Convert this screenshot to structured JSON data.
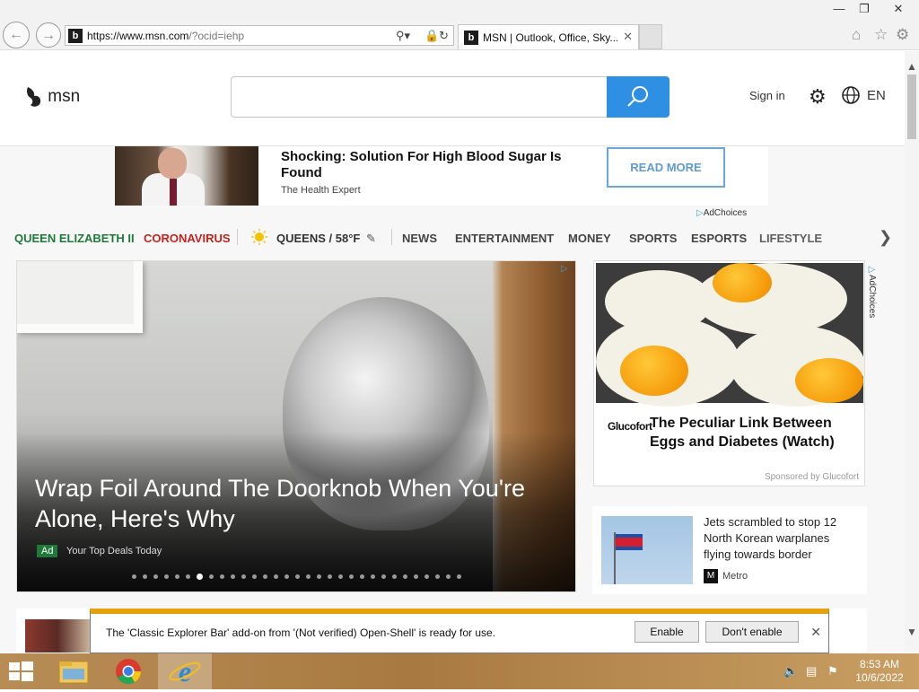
{
  "browser": {
    "url_main": "https://www.msn.com",
    "url_rest": "/?ocid=iehp",
    "tab_title": "MSN | Outlook, Office, Sky...",
    "favicon_letter": "b"
  },
  "msn": {
    "logo_text": "msn",
    "signin_label": "Sign in",
    "lang_label": "EN",
    "search_placeholder": ""
  },
  "ad_banner": {
    "title": "Shocking: Solution For High Blood Sugar Is Found",
    "source": "The Health Expert",
    "cta": "READ MORE",
    "adchoices": "AdChoices"
  },
  "nav": {
    "items": [
      {
        "label": "QUEEN ELIZABETH II",
        "color": "#1f7a3a"
      },
      {
        "label": "CORONAVIRUS",
        "color": "#c0241f"
      },
      {
        "label": "QUEENS / 58°F",
        "color": "#333333"
      },
      {
        "label": "NEWS",
        "color": "#444444"
      },
      {
        "label": "ENTERTAINMENT",
        "color": "#444444"
      },
      {
        "label": "MONEY",
        "color": "#444444"
      },
      {
        "label": "SPORTS",
        "color": "#444444"
      },
      {
        "label": "ESPORTS",
        "color": "#444444"
      },
      {
        "label": "LIFESTYLE",
        "color": "#444444"
      }
    ]
  },
  "hero": {
    "title": "Wrap Foil Around The Doorknob When You're Alone, Here's Why",
    "ad_badge": "Ad",
    "sponsor": "Your Top Deals Today",
    "dot_count": 31,
    "active_dot": 6
  },
  "side_ad": {
    "brand": "Glucofort",
    "title": "The Peculiar Link Between Eggs and Diabetes (Watch)",
    "sponsor": "Sponsored by Glucofort",
    "adchoices": "AdChoices"
  },
  "news_card": {
    "headline": "Jets scrambled to stop 12 North Korean warplanes flying towards border",
    "source": "Metro"
  },
  "notification": {
    "message": "The 'Classic Explorer Bar' add-on from '(Not verified) Open-Shell' is ready for use.",
    "enable_label": "Enable",
    "dont_enable_label": "Don't enable"
  },
  "taskbar": {
    "time": "8:53 AM",
    "date": "10/6/2022"
  },
  "colors": {
    "accent": "#2f8fe2",
    "ad_border": "#6aa6d9",
    "notify_bar": "#e6a20c"
  }
}
